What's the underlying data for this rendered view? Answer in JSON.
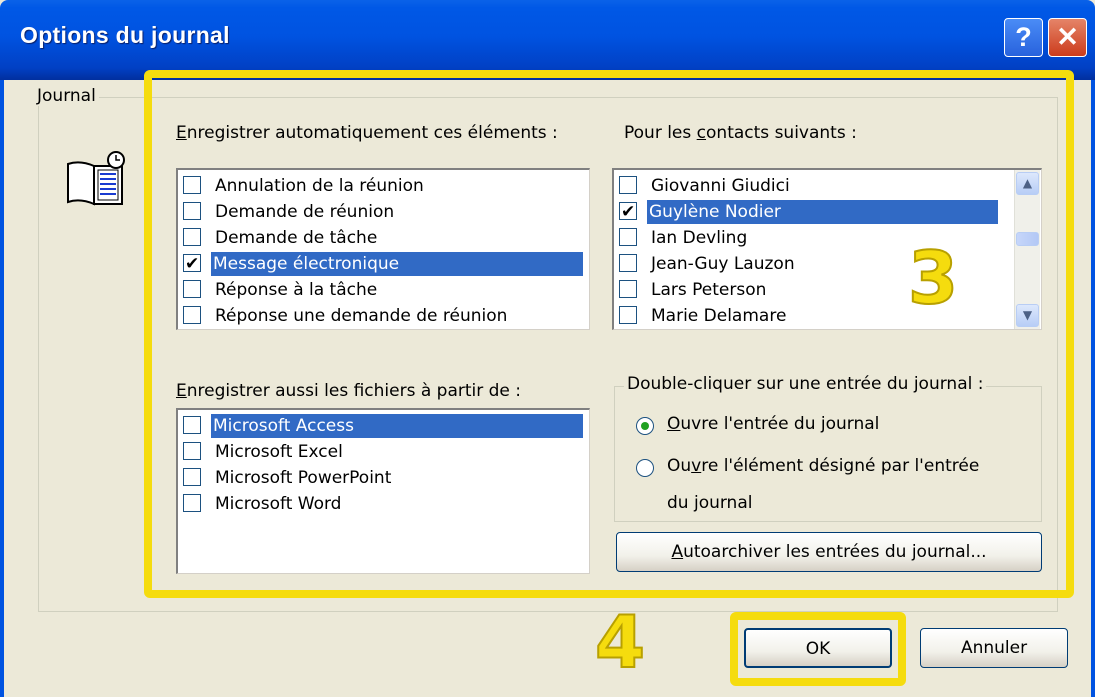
{
  "window": {
    "title": "Options du journal",
    "help_glyph": "?",
    "close_glyph": "✕"
  },
  "journal_group": {
    "legend": "Journal",
    "icon": "journal-icon"
  },
  "auto_record": {
    "label_pre": "",
    "label_ul": "E",
    "label_post": "nregistrer automatiquement ces éléments :",
    "items": [
      {
        "label": "Annulation de la réunion",
        "checked": false,
        "selected": false
      },
      {
        "label": "Demande de réunion",
        "checked": false,
        "selected": false
      },
      {
        "label": "Demande de tâche",
        "checked": false,
        "selected": false
      },
      {
        "label": "Message électronique",
        "checked": true,
        "selected": true
      },
      {
        "label": "Réponse à la tâche",
        "checked": false,
        "selected": false
      },
      {
        "label": "Réponse une demande de réunion",
        "checked": false,
        "selected": false
      }
    ]
  },
  "contacts": {
    "label_pre": "Pour les ",
    "label_ul": "c",
    "label_post": "ontacts suivants :",
    "items": [
      {
        "label": "Giovanni Giudici",
        "checked": false,
        "selected": false
      },
      {
        "label": "Guylène Nodier",
        "checked": true,
        "selected": true
      },
      {
        "label": "Ian Devling",
        "checked": false,
        "selected": false
      },
      {
        "label": "Jean-Guy Lauzon",
        "checked": false,
        "selected": false
      },
      {
        "label": "Lars Peterson",
        "checked": false,
        "selected": false
      },
      {
        "label": "Marie Delamare",
        "checked": false,
        "selected": false
      }
    ]
  },
  "files": {
    "label_pre": "",
    "label_ul": "E",
    "label_post": "nregistrer aussi les fichiers à partir de :",
    "items": [
      {
        "label": "Microsoft Access",
        "checked": false,
        "selected": true
      },
      {
        "label": "Microsoft Excel",
        "checked": false,
        "selected": false
      },
      {
        "label": "Microsoft PowerPoint",
        "checked": false,
        "selected": false
      },
      {
        "label": "Microsoft Word",
        "checked": false,
        "selected": false
      }
    ]
  },
  "double_click": {
    "legend": "Double-cliquer sur une entrée du journal :",
    "option1_ul": "O",
    "option1_rest": "uvre l'entrée du journal",
    "option2_pre": "Ou",
    "option2_ul": "v",
    "option2_line1": "re l'élément désigné par l'entrée",
    "option2_line2": "du journal",
    "selected": 1
  },
  "autoarchive": {
    "ul": "A",
    "rest": "utoarchiver les entrées du journal..."
  },
  "buttons": {
    "ok": "OK",
    "cancel": "Annuler"
  },
  "annotations": {
    "step3": "3",
    "step4": "4",
    "color": "#f5dc0e"
  }
}
